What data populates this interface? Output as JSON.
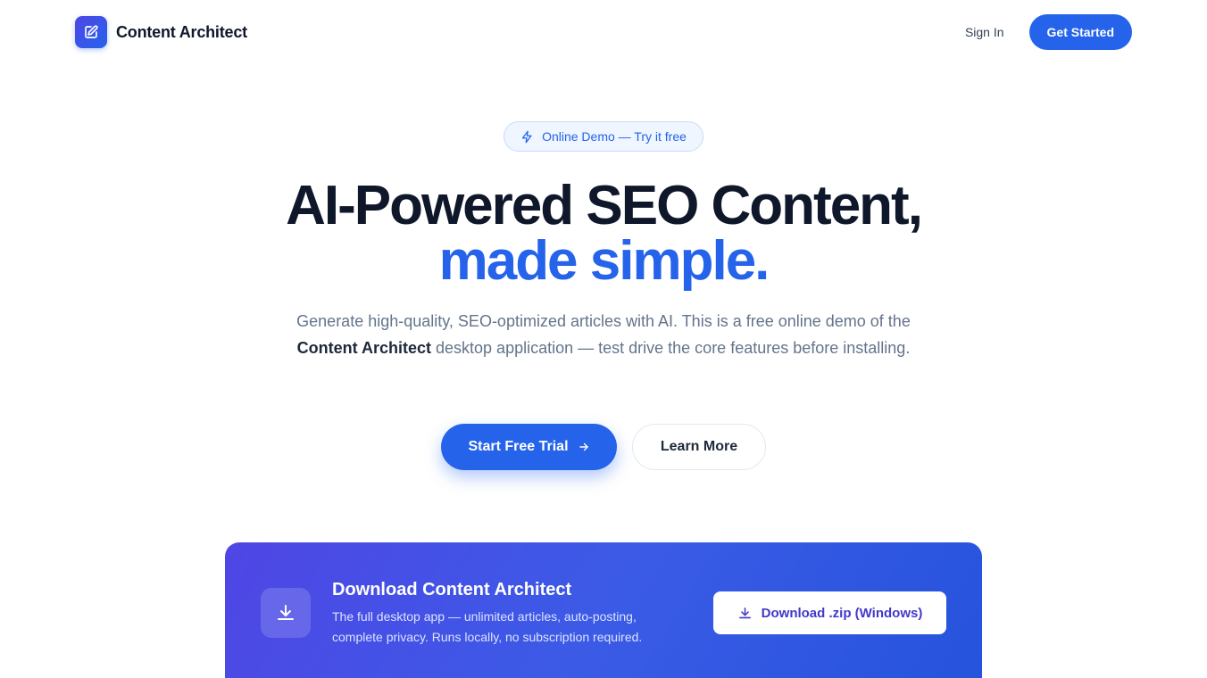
{
  "header": {
    "brand": "Content Architect",
    "sign_in": "Sign In",
    "get_started": "Get Started"
  },
  "hero": {
    "badge": "Online Demo — Try it free",
    "headline_line1": "AI-Powered SEO Content,",
    "headline_line2": "made simple.",
    "subtext_before": "Generate high-quality, SEO-optimized articles with AI. This is a free online demo of the ",
    "subtext_bold": "Content Architect",
    "subtext_after": " desktop application — test drive the core features before installing.",
    "primary_cta": "Start Free Trial",
    "secondary_cta": "Learn More"
  },
  "download": {
    "title": "Download Content Architect",
    "description": "The full desktop app — unlimited articles, auto-posting, complete privacy. Runs locally, no subscription required.",
    "button": "Download .zip (Windows)"
  },
  "colors": {
    "accent": "#2563eb",
    "heading": "#0f172a",
    "muted": "#64748b",
    "card_gradient_start": "#4f46e5",
    "card_gradient_end": "#2553dc"
  },
  "icons": {
    "logo": "edit-square-icon",
    "badge": "lightning-icon",
    "cta": "arrow-right-icon",
    "download": "download-icon"
  }
}
